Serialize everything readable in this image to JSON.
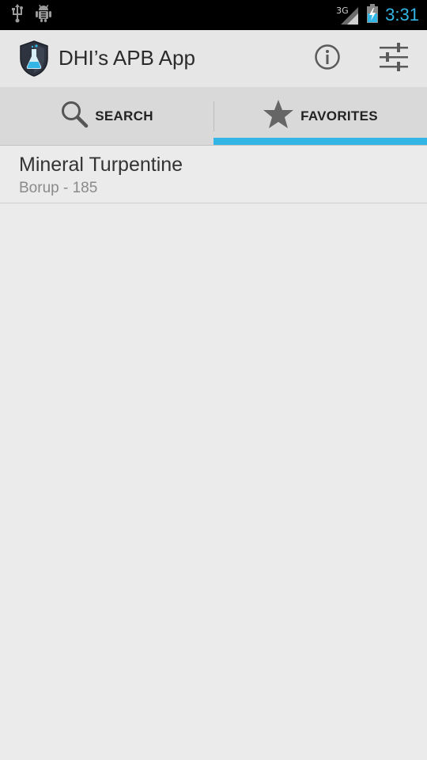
{
  "status_bar": {
    "network_type": "3G",
    "time": "3:31",
    "icons": [
      "usb-icon",
      "android-debug-icon",
      "signal-icon",
      "battery-charging-icon"
    ]
  },
  "action_bar": {
    "title": "DHI’s APB App",
    "icons": [
      "app-logo-icon",
      "info-icon",
      "settings-sliders-icon"
    ]
  },
  "tabs": [
    {
      "label": "SEARCH",
      "icon": "search-icon",
      "selected": false
    },
    {
      "label": "FAVORITES",
      "icon": "star-icon",
      "selected": true
    }
  ],
  "favorites": [
    {
      "title": "Mineral Turpentine",
      "subtitle": "Borup - 185"
    }
  ],
  "colors": {
    "accent": "#33b5e5",
    "background": "#ebebeb",
    "action_bar": "#e6e6e6",
    "tab_bar": "#d9d9d9"
  }
}
